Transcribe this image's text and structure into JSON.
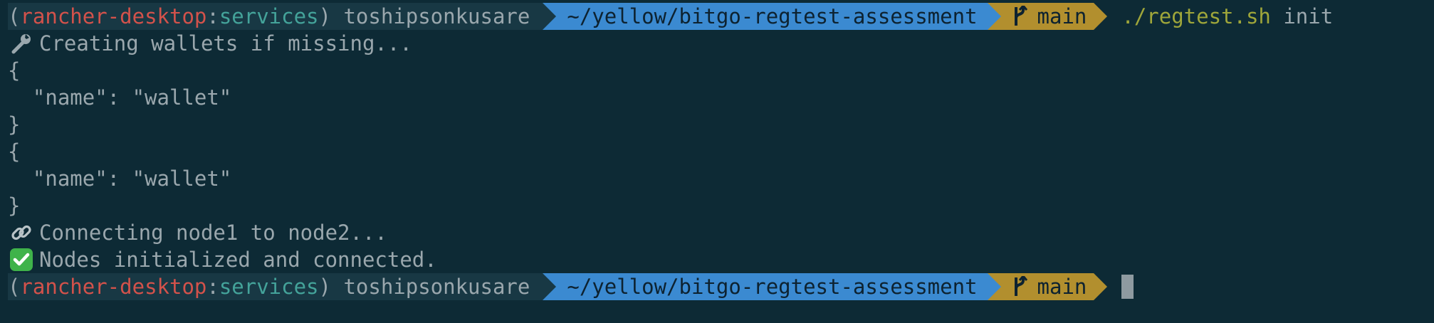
{
  "prompt": {
    "paren_open": "(",
    "host": "rancher-desktop",
    "colon": ":",
    "ns": "services",
    "paren_close": ")",
    "user": " toshipsonkusare",
    "path": "~/yellow/bitgo-regtest-assessment",
    "branch": "main",
    "colors": {
      "context_bg": "#183844",
      "path_bg": "#3b8ad1",
      "git_bg": "#b28f2e",
      "red": "#d3524b",
      "teal": "#44a39a"
    }
  },
  "command": {
    "exe": "./regtest.sh",
    "arg": " init"
  },
  "output": {
    "creating": "Creating wallets if missing...",
    "brace_open_1": "{",
    "name_line_1": "  \"name\": \"wallet\"",
    "brace_close_1": "}",
    "brace_open_2": "{",
    "name_line_2": "  \"name\": \"wallet\"",
    "brace_close_2": "}",
    "connecting": "Connecting node1 to node2...",
    "initialized": "Nodes initialized and connected."
  },
  "icons": {
    "creating": "wrench-icon",
    "connecting": "link-icon",
    "initialized": "check-mark-icon",
    "branch": "git-branch-icon"
  }
}
